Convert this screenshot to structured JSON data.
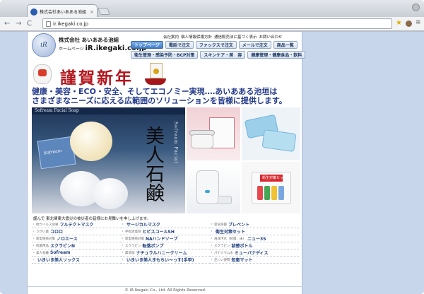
{
  "browser": {
    "tab_title": "株式会社あいあある池組",
    "tab_close": "×",
    "back": "←",
    "forward": "→",
    "reload": "C",
    "url": "ir.ikegaki.co.jp",
    "star": "★",
    "menu": "≡"
  },
  "header": {
    "logo_text": "iR",
    "company": "株式会社 あいあある池組",
    "homepage_prefix": "ホームページ",
    "homepage_url": "iR.ikegaki.co.jp"
  },
  "top_links": [
    "会社案内",
    "個人情報保護方針",
    "通信販売法に基づく表示",
    "お問い合わせ"
  ],
  "nav_row1": [
    "トップページ",
    "電話で注文",
    "ファックスで注文",
    "メールで注文",
    "商品一覧"
  ],
  "nav_row2": [
    "衛生管理・感染予防・BCP対策",
    "スキンケア・美　容",
    "健康管理・健康食品・飲料"
  ],
  "banner": {
    "greeting": "謹賀新年",
    "slogan_line1": "健康・美容・ECO・安全、そしてエコノミー実現‥‥あいあある池垣は",
    "slogan_line2": "さまざまなニーズに応える広範囲のソリューションを皆様に提供します。"
  },
  "soap": {
    "header": "Sofream Facial Soap",
    "box_label": "Sofream",
    "headline": "美人石鹸",
    "vertical_sub": "Sofream Facial"
  },
  "kit": {
    "tag": "衛生対策セット"
  },
  "greet2": "謹んで 東北関東大震災の被災者の皆様にお見舞いを申し上げます。",
  "products": {
    "col1": [
      {
        "cat": "抗ウイルス効果",
        "name": "フルテクトマスク"
      },
      {
        "cat": "うがい薬",
        "name": "コロロ"
      },
      {
        "cat": "新型感染対策",
        "name": "ノロエース"
      },
      {
        "cat": "抗菌用品",
        "name": "スクラビンN"
      },
      {
        "cat": "美人石鹸",
        "name": "Sofream"
      },
      {
        "cat": "",
        "name": "いきいき美人ソックス"
      }
    ],
    "col2": [
      {
        "cat": "",
        "name": "サージカルマスク"
      },
      {
        "cat": "手指消毒剤",
        "name": "ヒビスコールSH"
      },
      {
        "cat": "新型感染対策",
        "name": "NAハンドソープ"
      },
      {
        "cat": "スクラビン",
        "name": "転落ボンプ"
      },
      {
        "cat": "無添加",
        "name": "ナチュラルハニークリーム"
      },
      {
        "cat": "",
        "name": "いきいき美人きもちい～っす(手甲)"
      }
    ],
    "col3": [
      {
        "cat": "空気除菌",
        "name": "プレベント"
      },
      {
        "cat": "",
        "name": "衛生対策セット"
      },
      {
        "cat": "海洋汚水（抗菌、床）",
        "name": "ニュー3S"
      },
      {
        "cat": "スクラビン",
        "name": "詰替ボトル"
      },
      {
        "cat": "パナジウム水",
        "name": "ミューバナディス"
      },
      {
        "cat": "正しい姿勢",
        "name": "知恵マット"
      }
    ]
  },
  "footer": "© iR-Ikegaki Co., Ltd. All Rights Reserved."
}
